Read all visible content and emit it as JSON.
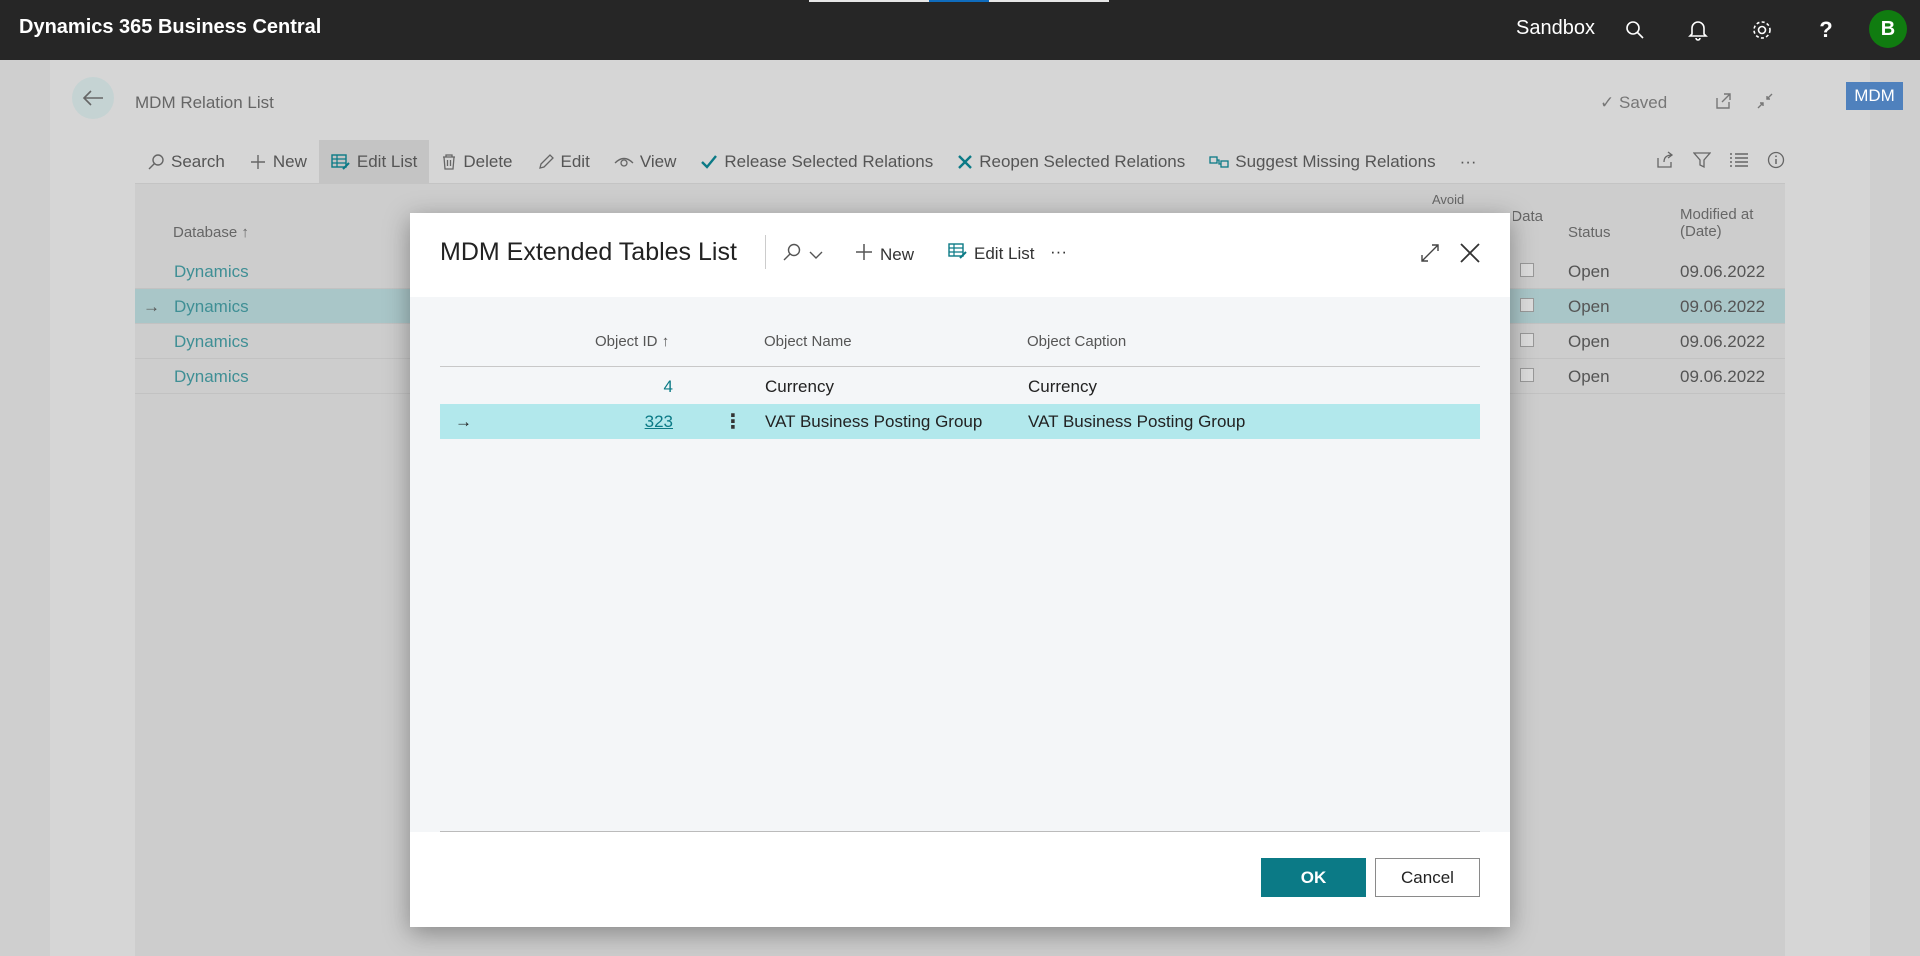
{
  "app": {
    "title": "Dynamics 365 Business Central",
    "environment": "Sandbox",
    "avatar_initial": "B"
  },
  "page": {
    "title": "MDM Relation List",
    "saved_label": "Saved",
    "badge": "MDM",
    "actions": [
      {
        "label": "Search",
        "icon": "search-icon"
      },
      {
        "label": "New",
        "icon": "plus-icon"
      },
      {
        "label": "Edit List",
        "icon": "edit-list-icon"
      },
      {
        "label": "Delete",
        "icon": "trash-icon"
      },
      {
        "label": "Edit",
        "icon": "pencil-icon"
      },
      {
        "label": "View",
        "icon": "eye-icon"
      },
      {
        "label": "Release Selected Relations",
        "icon": "check-icon"
      },
      {
        "label": "Reopen Selected Relations",
        "icon": "x-icon"
      },
      {
        "label": "Suggest Missing Relations",
        "icon": "relations-icon"
      }
    ],
    "more": "···",
    "columns": {
      "database": "Database",
      "avoid_top": "Avoid",
      "elec_data": "Elec... Data",
      "status": "Status",
      "modified": "Modified at (Date)"
    },
    "rows": [
      {
        "database": "Dynamics",
        "status": "Open",
        "modified": "09.06.2022"
      },
      {
        "database": "Dynamics",
        "status": "Open",
        "modified": "09.06.2022"
      },
      {
        "database": "Dynamics",
        "status": "Open",
        "modified": "09.06.2022"
      },
      {
        "database": "Dynamics",
        "status": "Open",
        "modified": "09.06.2022"
      }
    ]
  },
  "dialog": {
    "title": "MDM Extended Tables List",
    "actions": {
      "new": "New",
      "edit_list": "Edit List",
      "more": "···"
    },
    "columns": {
      "object_id": "Object ID",
      "object_name": "Object Name",
      "object_caption": "Object Caption"
    },
    "rows": [
      {
        "object_id": "4",
        "object_name": "Currency",
        "object_caption": "Currency"
      },
      {
        "object_id": "323",
        "object_name": "VAT Business Posting Group",
        "object_caption": "VAT Business Posting Group"
      }
    ],
    "ok_label": "OK",
    "cancel_label": "Cancel"
  },
  "colors": {
    "accent": "#0b7a86",
    "selected_row": "#b2e8ec",
    "topbar": "#262626",
    "avatar": "#107c10",
    "mdm_badge": "#4f81bd"
  }
}
